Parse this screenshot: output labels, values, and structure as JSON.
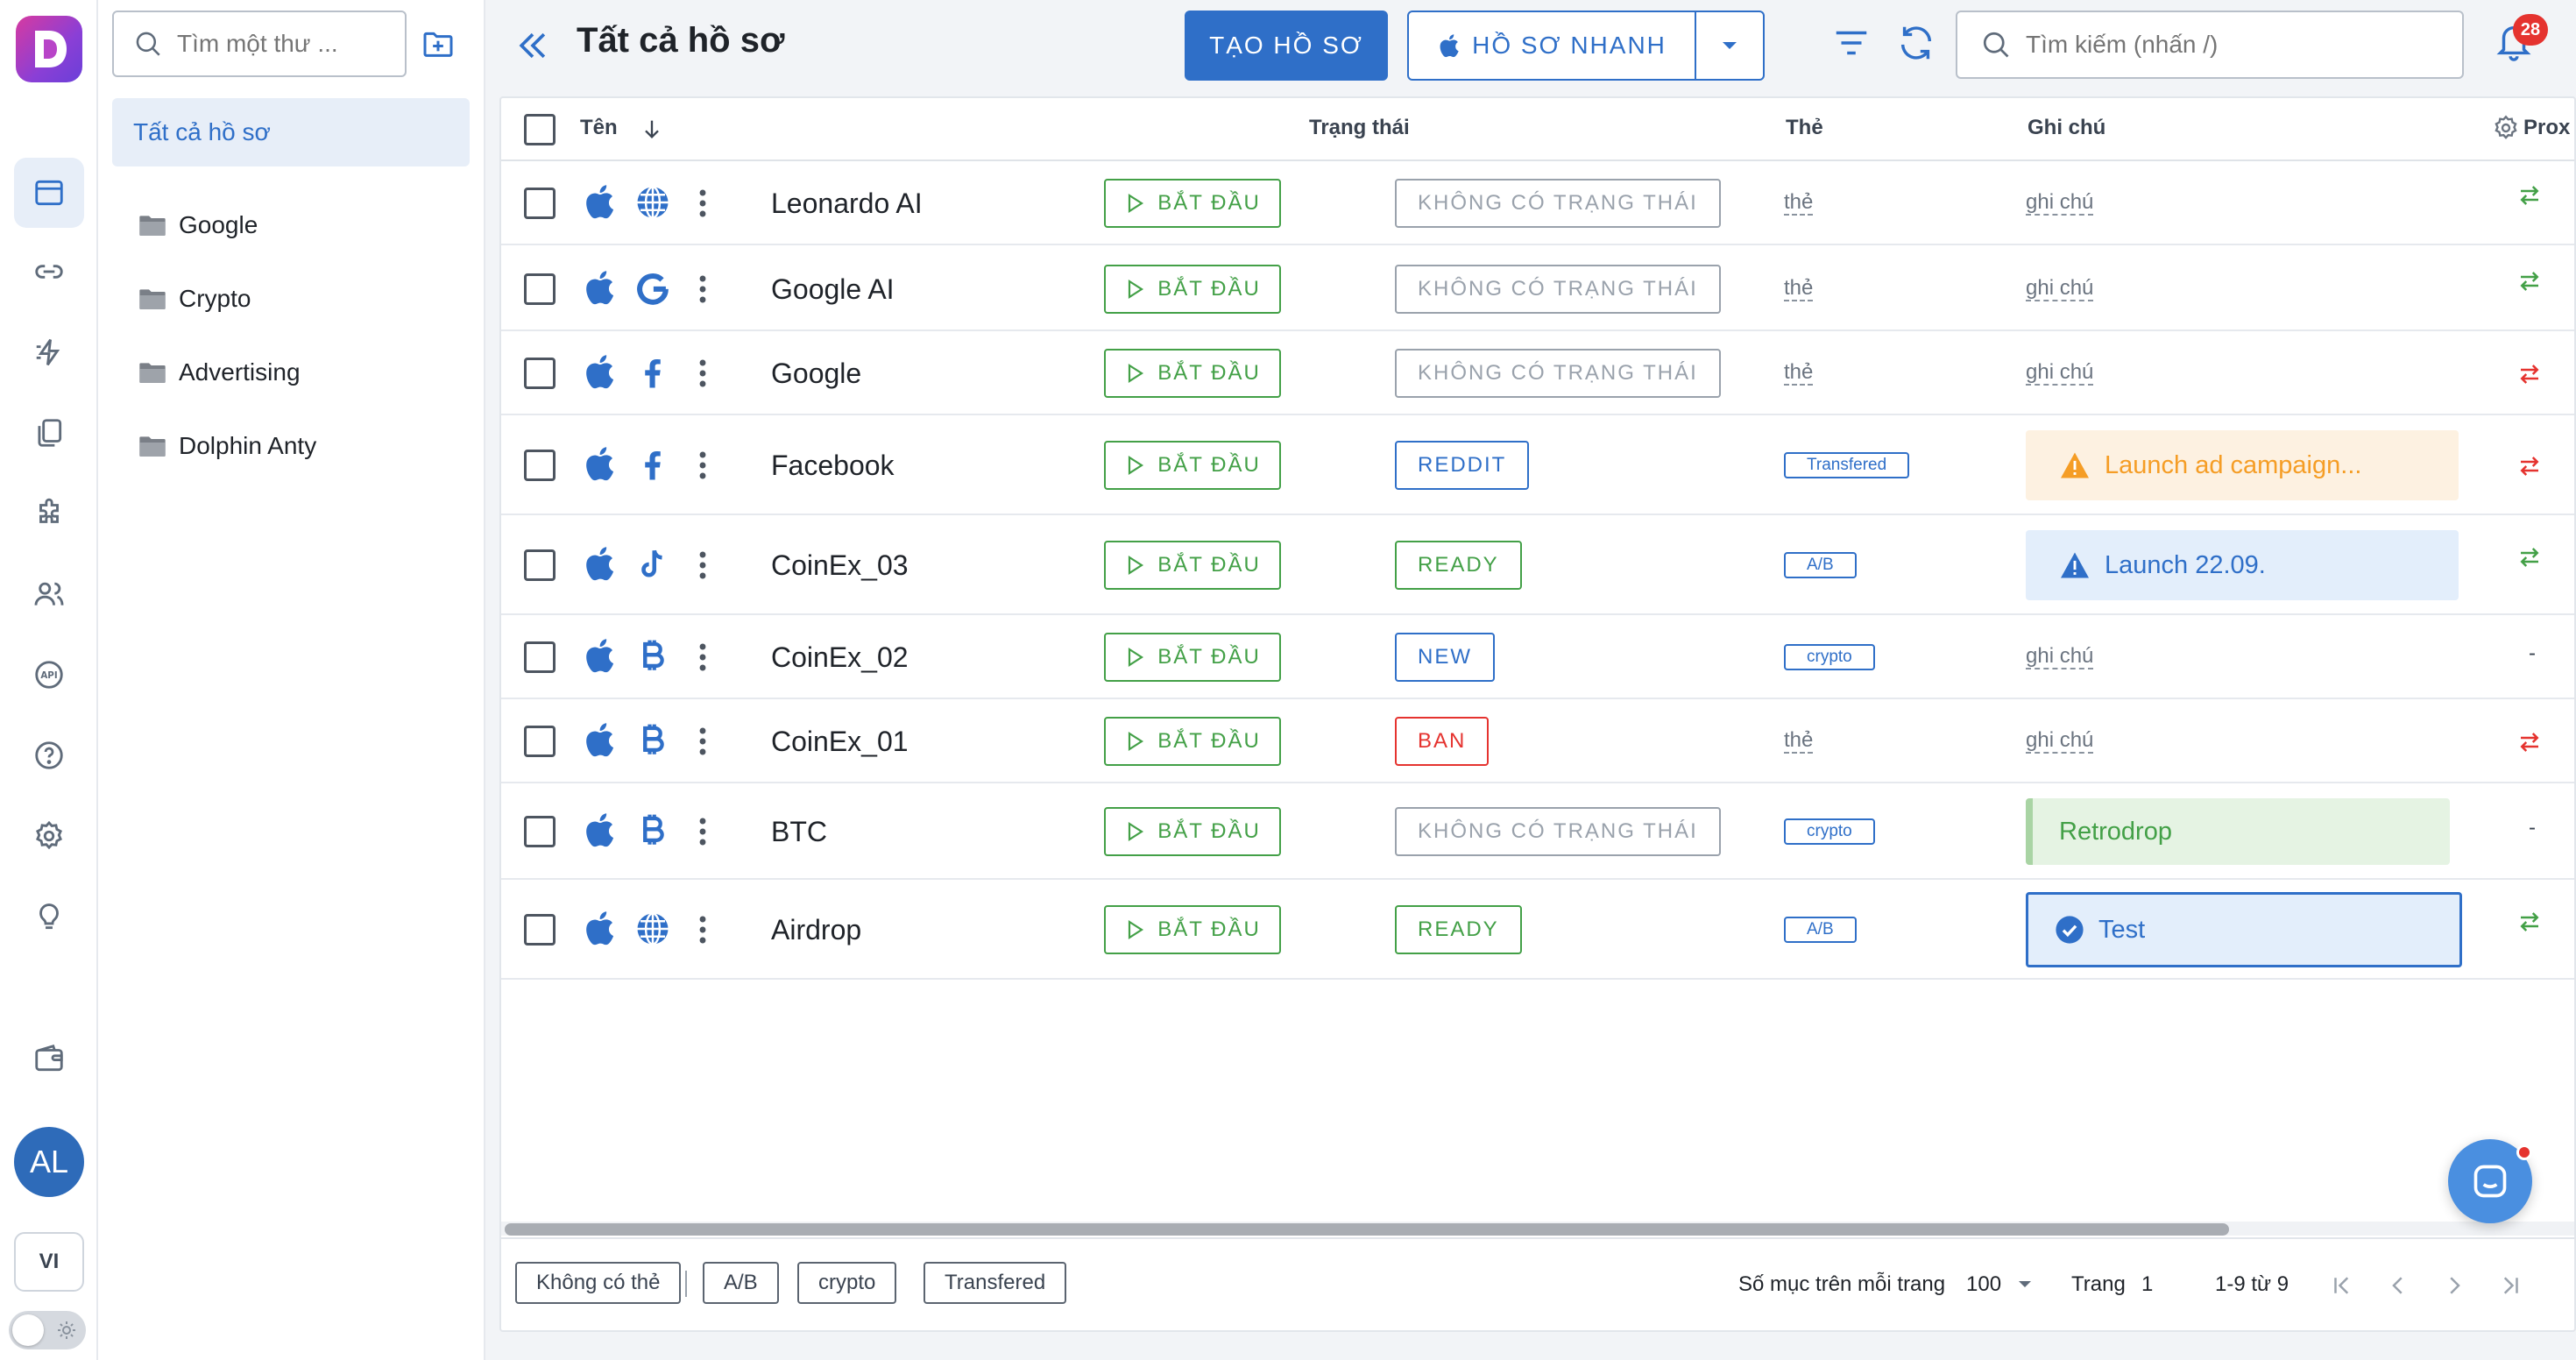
{
  "sidebar": {
    "avatar_initials": "AL",
    "language": "VI",
    "nav_icons": [
      "profiles-icon",
      "link-icon",
      "automation-icon",
      "clipboard-icon",
      "extension-icon",
      "team-icon",
      "api-icon",
      "help-icon",
      "settings-icon",
      "idea-icon",
      "wallet-icon"
    ]
  },
  "folders": {
    "search_placeholder": "Tìm một thư ...",
    "all_label": "Tất cả hồ sơ",
    "items": [
      {
        "label": "Google"
      },
      {
        "label": "Crypto"
      },
      {
        "label": "Advertising"
      },
      {
        "label": "Dolphin Anty"
      }
    ]
  },
  "header": {
    "title": "Tất cả hồ sơ",
    "create_label": "TẠO HỒ SƠ",
    "quick_label": "HỒ SƠ NHANH",
    "search_placeholder": "Tìm kiếm (nhấn /)",
    "notification_count": "28"
  },
  "table": {
    "columns": {
      "name": "Tên",
      "status": "Trạng thái",
      "tags": "Thẻ",
      "notes": "Ghi chú",
      "proxy": "Prox"
    },
    "start_label": "BẮT ĐẦU",
    "tag_placeholder": "thẻ",
    "note_placeholder": "ghi chú",
    "rows": [
      {
        "name": "Leonardo AI",
        "site_icon": "globe-icon",
        "status": "KHÔNG CÓ TRẠNG THÁI",
        "status_color": "#9aa2ac",
        "tag": "",
        "note": "",
        "note_style": "",
        "proxy": "green"
      },
      {
        "name": "Google AI",
        "site_icon": "google-icon",
        "status": "KHÔNG CÓ TRẠNG THÁI",
        "status_color": "#9aa2ac",
        "tag": "",
        "note": "",
        "note_style": "",
        "proxy": "green"
      },
      {
        "name": "Google",
        "site_icon": "facebook-icon",
        "status": "KHÔNG CÓ TRẠNG THÁI",
        "status_color": "#9aa2ac",
        "tag": "",
        "note": "",
        "note_style": "",
        "proxy": "red"
      },
      {
        "name": "Facebook",
        "site_icon": "facebook-icon",
        "status": "REDDIT",
        "status_color": "#2f6fc8",
        "tag": "Transfered",
        "note": "Launch ad campaign...",
        "note_style": "warning",
        "proxy": "red"
      },
      {
        "name": "CoinEx_03",
        "site_icon": "tiktok-icon",
        "status": "READY",
        "status_color": "#43a047",
        "tag": "A/B",
        "note": "Launch 22.09.",
        "note_style": "info",
        "proxy": "green"
      },
      {
        "name": "CoinEx_02",
        "site_icon": "bitcoin-icon",
        "status": "NEW",
        "status_color": "#2f6fc8",
        "tag": "crypto",
        "note": "",
        "note_style": "",
        "proxy": "none"
      },
      {
        "name": "CoinEx_01",
        "site_icon": "bitcoin-icon",
        "status": "BAN",
        "status_color": "#e5332f",
        "tag": "",
        "note": "",
        "note_style": "",
        "proxy": "red"
      },
      {
        "name": "BTC",
        "site_icon": "bitcoin-icon",
        "status": "KHÔNG CÓ TRẠNG THÁI",
        "status_color": "#9aa2ac",
        "tag": "crypto",
        "note": "Retrodrop",
        "note_style": "success",
        "proxy": "none"
      },
      {
        "name": "Airdrop",
        "site_icon": "globe-icon",
        "status": "READY",
        "status_color": "#43a047",
        "tag": "A/B",
        "note": "Test",
        "note_style": "selected",
        "proxy": "green"
      }
    ],
    "proxy_dash": "-"
  },
  "footer": {
    "chips": [
      "Không có thẻ",
      "A/B",
      "crypto",
      "Transfered"
    ],
    "per_page_label": "Số mục trên mỗi trang",
    "per_page_value": "100",
    "page_label": "Trang",
    "page_value": "1",
    "range_text": "1-9 từ 9"
  },
  "colors": {
    "accent": "#2f6fc8",
    "start_green": "#43a047",
    "danger": "#e5332f"
  }
}
